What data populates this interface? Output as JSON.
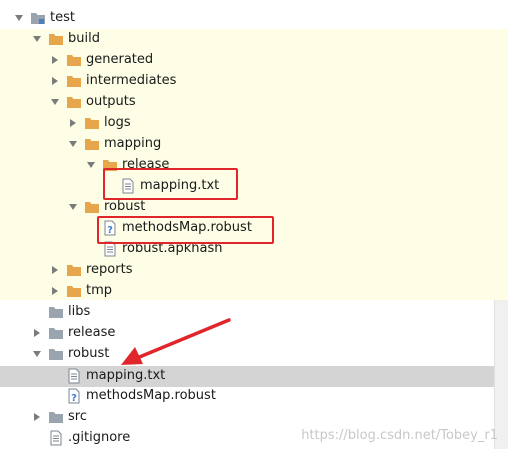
{
  "tree": {
    "nodes": [
      {
        "label": "test",
        "icon": "module-folder-icon",
        "expanded": true
      },
      {
        "label": "build",
        "icon": "folder-icon",
        "expanded": true
      },
      {
        "label": "generated",
        "icon": "folder-icon",
        "expanded": false
      },
      {
        "label": "intermediates",
        "icon": "folder-icon",
        "expanded": false
      },
      {
        "label": "outputs",
        "icon": "folder-icon",
        "expanded": true
      },
      {
        "label": "logs",
        "icon": "folder-icon",
        "expanded": false
      },
      {
        "label": "mapping",
        "icon": "folder-icon",
        "expanded": true
      },
      {
        "label": "release",
        "icon": "folder-icon",
        "expanded": true
      },
      {
        "label": "mapping.txt",
        "icon": "text-file-icon"
      },
      {
        "label": "robust",
        "icon": "folder-icon",
        "expanded": true
      },
      {
        "label": "methodsMap.robust",
        "icon": "unknown-file-icon"
      },
      {
        "label": "robust.apkhash",
        "icon": "text-file-icon"
      },
      {
        "label": "reports",
        "icon": "folder-icon",
        "expanded": false
      },
      {
        "label": "tmp",
        "icon": "folder-icon",
        "expanded": false
      },
      {
        "label": "libs",
        "icon": "gray-folder-icon"
      },
      {
        "label": "release",
        "icon": "gray-folder-icon",
        "expanded": false
      },
      {
        "label": "robust",
        "icon": "gray-folder-icon",
        "expanded": true
      },
      {
        "label": "mapping.txt",
        "icon": "text-file-icon",
        "selected": true
      },
      {
        "label": "methodsMap.robust",
        "icon": "unknown-file-icon"
      },
      {
        "label": "src",
        "icon": "gray-folder-icon",
        "expanded": false
      },
      {
        "label": ".gitignore",
        "icon": "text-file-icon"
      }
    ]
  },
  "watermark": "https://blog.csdn.net/Tobey_r1",
  "colors": {
    "folder_orange": "#e8a64c",
    "folder_gray": "#9aa4ae",
    "highlight_bg": "#fefde6",
    "selection_bg": "#d4d4d4",
    "annotation_red": "#e0262a"
  }
}
